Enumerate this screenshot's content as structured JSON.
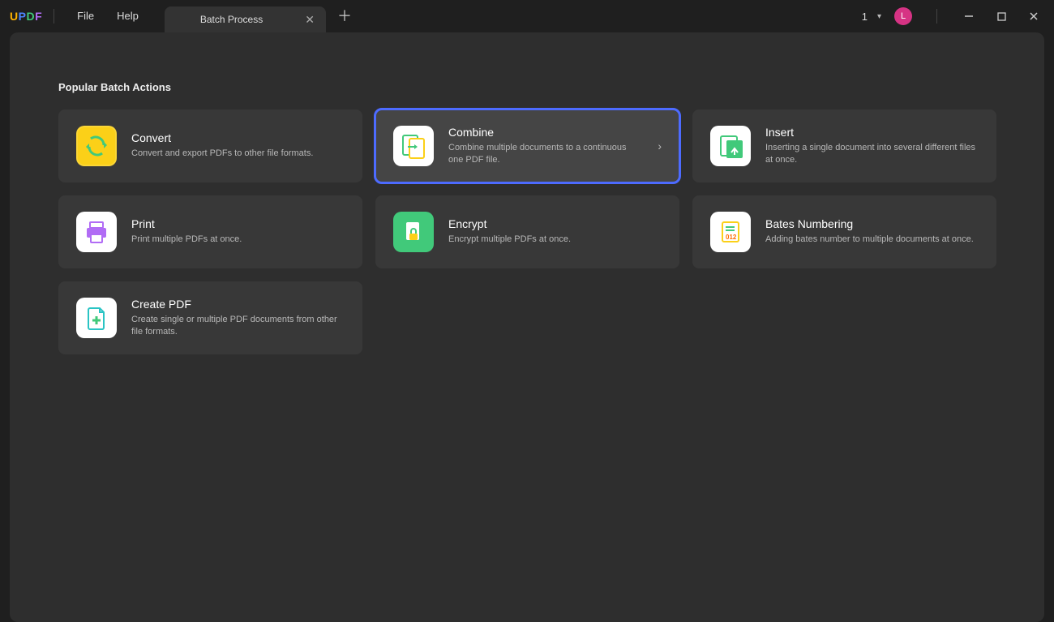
{
  "app": {
    "brand": "UPDF"
  },
  "menu": {
    "file": "File",
    "help": "Help"
  },
  "tab": {
    "label": "Batch Process"
  },
  "header": {
    "count": "1",
    "avatar_initial": "L"
  },
  "section_title": "Popular Batch Actions",
  "cards": {
    "convert": {
      "title": "Convert",
      "desc": "Convert and export PDFs to other file formats."
    },
    "combine": {
      "title": "Combine",
      "desc": "Combine multiple documents to a continuous one PDF file."
    },
    "insert": {
      "title": "Insert",
      "desc": "Inserting a single document into several different files at once."
    },
    "print": {
      "title": "Print",
      "desc": "Print multiple PDFs at once."
    },
    "encrypt": {
      "title": "Encrypt",
      "desc": "Encrypt multiple PDFs at once."
    },
    "bates": {
      "title": "Bates Numbering",
      "desc": "Adding bates number to multiple documents at once."
    },
    "create": {
      "title": "Create PDF",
      "desc": "Create single or multiple PDF documents from other file formats."
    }
  },
  "selected_card": "combine"
}
